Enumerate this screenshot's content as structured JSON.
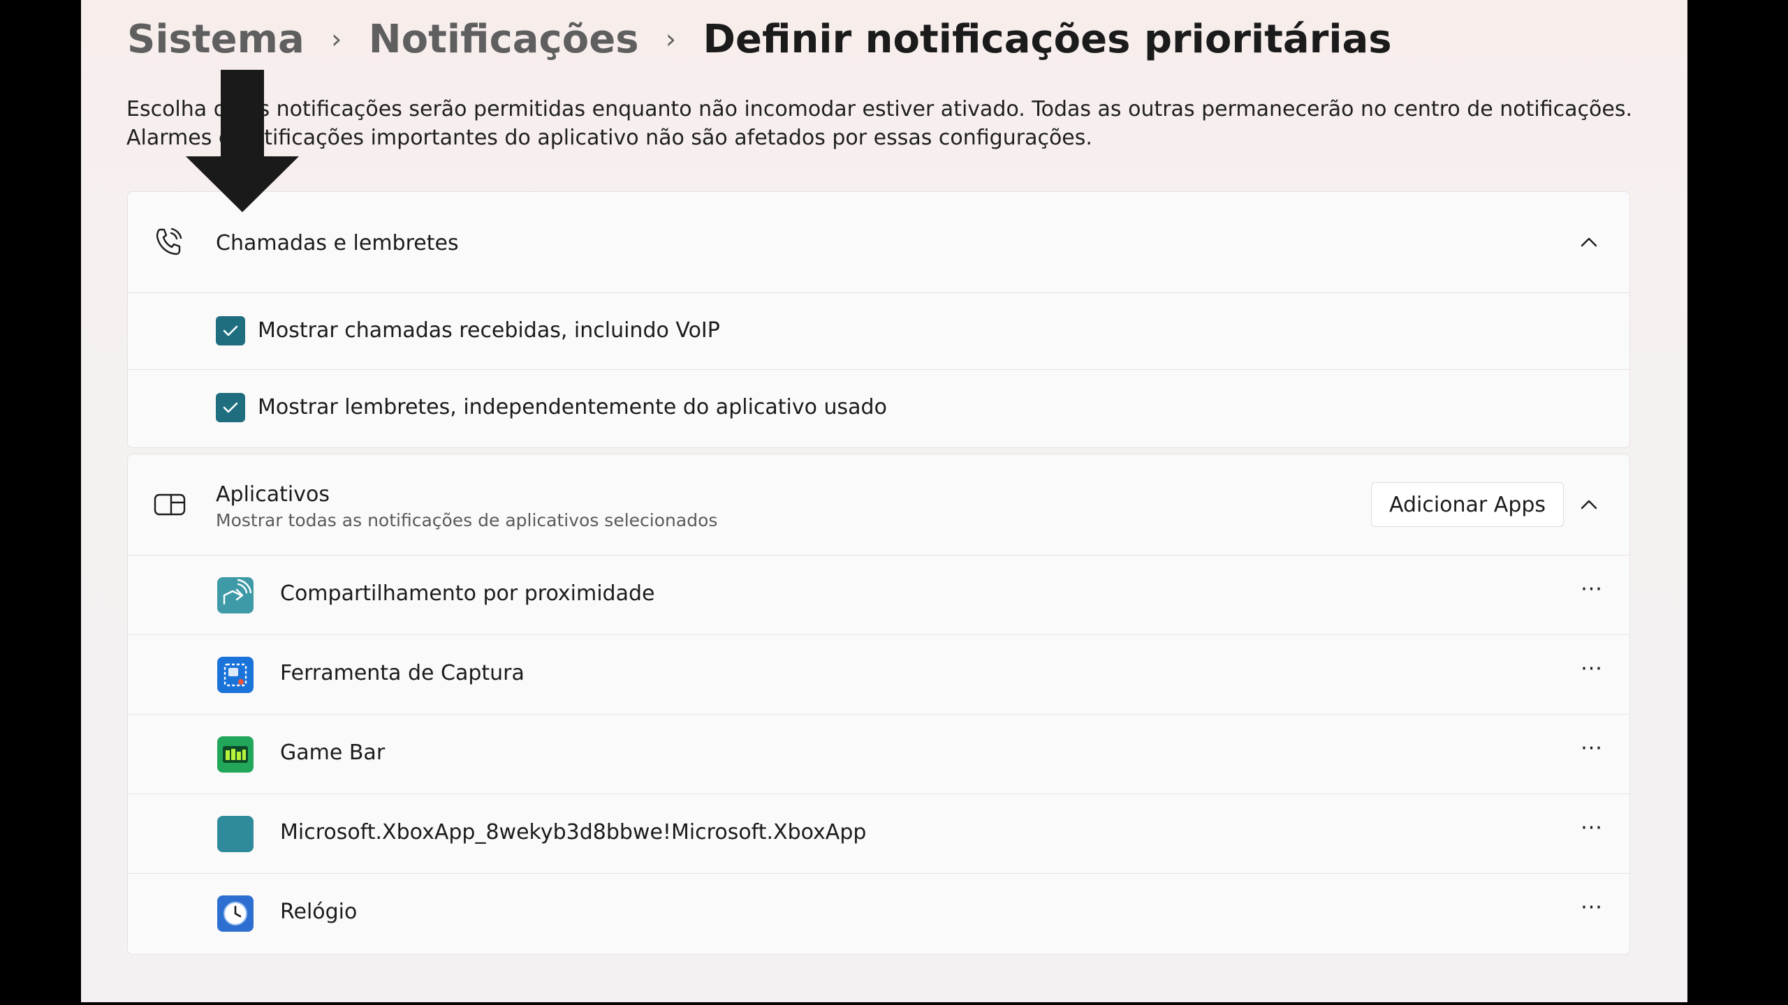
{
  "breadcrumb": {
    "items": [
      "Sistema",
      "Notificações"
    ],
    "current": "Definir notificações prioritárias"
  },
  "description": "Escolha quais notificações serão permitidas enquanto não incomodar estiver ativado. Todas as outras permanecerão no centro de notificações. Alarmes e notificações importantes do aplicativo não são afetados por essas configurações.",
  "calls_section": {
    "title": "Chamadas e lembretes",
    "icon": "phone-ringing-icon",
    "options": [
      {
        "label": "Mostrar chamadas recebidas, incluindo VoIP",
        "checked": true
      },
      {
        "label": "Mostrar lembretes, independentemente do aplicativo usado",
        "checked": true
      }
    ]
  },
  "apps_section": {
    "title": "Aplicativos",
    "subtitle": "Mostrar todas as notificações de aplicativos selecionados",
    "icon": "app-window-icon",
    "add_button": "Adicionar Apps",
    "more_label": "···",
    "apps": [
      {
        "name": "Compartilhamento por proximidade",
        "icon": "nearby-share-icon",
        "color": "#3d9aa6"
      },
      {
        "name": "Ferramenta de Captura",
        "icon": "snipping-tool-icon",
        "color": "#1a73d9"
      },
      {
        "name": "Game Bar",
        "icon": "game-bar-icon",
        "color": "#22a65a"
      },
      {
        "name": "Microsoft.XboxApp_8wekyb3d8bbwe!Microsoft.XboxApp",
        "icon": "xbox-app-icon",
        "color": "#2f8a9c"
      },
      {
        "name": "Relógio",
        "icon": "clock-icon",
        "color": "#2d6fd0"
      }
    ]
  },
  "colors": {
    "accent": "#1f6e80",
    "background": "#f5f1f1",
    "card": "#fbfafa"
  }
}
